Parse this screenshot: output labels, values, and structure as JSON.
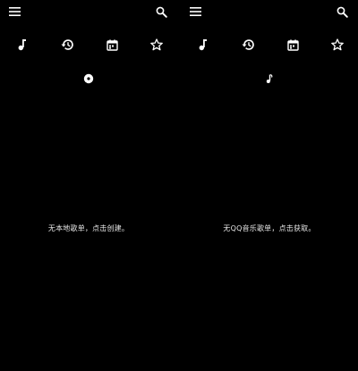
{
  "screens": [
    {
      "tab_icons": [
        "music-note-icon",
        "history-icon",
        "calendar-icon",
        "star-outline-icon"
      ],
      "page_indicator_icon": "disc-icon",
      "empty_message": "无本地歌单，点击创建。"
    },
    {
      "tab_icons": [
        "music-note-icon",
        "history-icon",
        "calendar-icon",
        "star-outline-icon"
      ],
      "page_indicator_icon": "music-note-small-icon",
      "empty_message": "无QQ音乐歌单，点击获取。"
    }
  ],
  "colors": {
    "background": "#000000",
    "foreground": "#ffffff",
    "text": "#e6e6e6"
  }
}
